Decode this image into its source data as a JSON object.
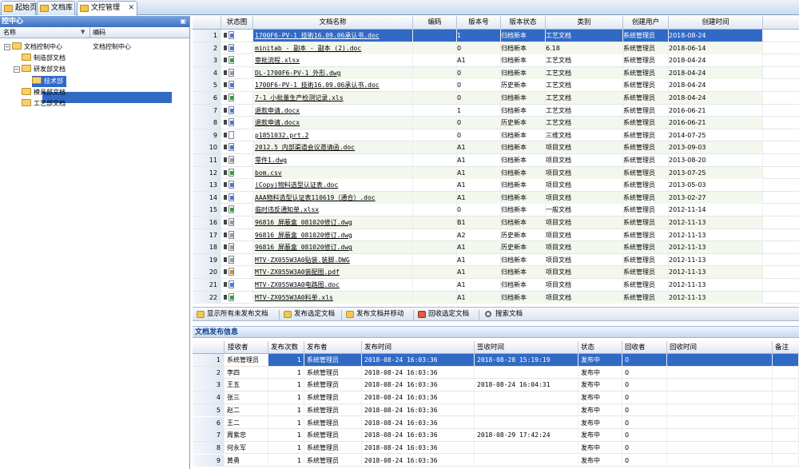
{
  "tabs": [
    {
      "label": "起始页",
      "active": false
    },
    {
      "label": "文档库",
      "active": false
    },
    {
      "label": "文控管理",
      "active": true
    }
  ],
  "tab_close": "✕",
  "left_panel": {
    "title": "控中心",
    "pin": "▣",
    "col_name": "名称",
    "col_code": "编码",
    "tree": [
      {
        "label": "文档控制中心",
        "code": "文档控制中心",
        "level": 0,
        "expanded": true
      },
      {
        "label": "制造部文档",
        "code": "",
        "level": 1,
        "expanded": false
      },
      {
        "label": "研发部文档",
        "code": "",
        "level": 1,
        "expanded": true
      },
      {
        "label": "技术部",
        "code": "",
        "level": 2,
        "selected": true
      },
      {
        "label": "模具部文档",
        "code": "",
        "level": 1,
        "expanded": false
      },
      {
        "label": "工艺部文档",
        "code": "",
        "level": 1,
        "expanded": false
      }
    ]
  },
  "doc_grid": {
    "headers": [
      "状态图",
      "文档名称",
      "编码",
      "版本号",
      "版本状态",
      "类别",
      "创建用户",
      "创建时间"
    ],
    "rows": [
      {
        "n": "1",
        "icon": "doc",
        "name": "1700F6-PV-1 技術16.09.06承认书.doc",
        "code": "",
        "ver": "1",
        "state": "归档新本",
        "cat": "工艺文档",
        "user": "系统管理员",
        "time": "2018-08-24"
      },
      {
        "n": "2",
        "icon": "doc",
        "name": "minitab - 副本 - 副本 (2).doc",
        "code": "",
        "ver": "0",
        "state": "归档新本",
        "cat": "6.18",
        "user": "系统管理员",
        "time": "2018-06-14"
      },
      {
        "n": "3",
        "icon": "xls",
        "name": "审批流程.xlsx",
        "code": "",
        "ver": "A1",
        "state": "归档新本",
        "cat": "工艺文档",
        "user": "系统管理员",
        "time": "2018-04-24"
      },
      {
        "n": "4",
        "icon": "dwg",
        "name": "DL-1700F6-PV-1 外形.dwg",
        "code": "",
        "ver": "0",
        "state": "归档新本",
        "cat": "工艺文档",
        "user": "系统管理员",
        "time": "2018-04-24"
      },
      {
        "n": "5",
        "icon": "doc",
        "name": "1700F6-PV-1 技術16.09.06承认书.doc",
        "code": "",
        "ver": "0",
        "state": "历史新本",
        "cat": "工艺文档",
        "user": "系统管理员",
        "time": "2018-04-24"
      },
      {
        "n": "6",
        "icon": "xls",
        "name": "7-1 小批量生产检测记录.xls",
        "code": "",
        "ver": "0",
        "state": "归档新本",
        "cat": "工艺文档",
        "user": "系统管理员",
        "time": "2018-04-24"
      },
      {
        "n": "7",
        "icon": "doc",
        "name": "退款申请.docx",
        "code": "",
        "ver": "1",
        "state": "归档新本",
        "cat": "工艺文档",
        "user": "系统管理员",
        "time": "2016-06-21"
      },
      {
        "n": "8",
        "icon": "doc",
        "name": "退款申请.docx",
        "code": "",
        "ver": "0",
        "state": "历史新本",
        "cat": "工艺文档",
        "user": "系统管理员",
        "time": "2016-06-21"
      },
      {
        "n": "9",
        "icon": "blank",
        "name": "p1851032.prt.2",
        "code": "",
        "ver": "0",
        "state": "归档新本",
        "cat": "三维文档",
        "user": "系统管理员",
        "time": "2014-07-25"
      },
      {
        "n": "10",
        "icon": "doc",
        "name": "2012.5 内部渠道会议邀请函.doc",
        "code": "",
        "ver": "A1",
        "state": "归档新本",
        "cat": "项目文档",
        "user": "系统管理员",
        "time": "2013-09-03"
      },
      {
        "n": "11",
        "icon": "dwg",
        "name": "零件1.dwg",
        "code": "",
        "ver": "A1",
        "state": "归档新本",
        "cat": "项目文档",
        "user": "系统管理员",
        "time": "2013-08-20"
      },
      {
        "n": "12",
        "icon": "xls",
        "name": "bom.csv",
        "code": "",
        "ver": "A1",
        "state": "归档新本",
        "cat": "项目文档",
        "user": "系统管理员",
        "time": "2013-07-25"
      },
      {
        "n": "13",
        "icon": "doc",
        "name": "(Copy)物料选型认证表.doc",
        "code": "",
        "ver": "A1",
        "state": "归档新本",
        "cat": "项目文档",
        "user": "系统管理员",
        "time": "2013-05-03"
      },
      {
        "n": "14",
        "icon": "doc",
        "name": "AAA物料选型认证表110619（通合）.doc",
        "code": "",
        "ver": "A1",
        "state": "归档新本",
        "cat": "项目文档",
        "user": "系统管理员",
        "time": "2013-02-27"
      },
      {
        "n": "15",
        "icon": "xls",
        "name": "临时违反通知单.xlsx",
        "code": "",
        "ver": "0",
        "state": "归档新本",
        "cat": "一般文档",
        "user": "系统管理员",
        "time": "2012-11-14"
      },
      {
        "n": "16",
        "icon": "dwg",
        "name": "96816 屏蔽盒 081020修订.dwg",
        "code": "",
        "ver": "B1",
        "state": "归档新本",
        "cat": "项目文档",
        "user": "系统管理员",
        "time": "2012-11-13"
      },
      {
        "n": "17",
        "icon": "dwg",
        "name": "96816 屏蔽盒 081020修订.dwg",
        "code": "",
        "ver": "A2",
        "state": "历史新本",
        "cat": "项目文档",
        "user": "系统管理员",
        "time": "2012-11-13"
      },
      {
        "n": "18",
        "icon": "dwg",
        "name": "96816 屏蔽盒 081020修订.dwg",
        "code": "",
        "ver": "A1",
        "state": "历史新本",
        "cat": "项目文档",
        "user": "系统管理员",
        "time": "2012-11-13"
      },
      {
        "n": "19",
        "icon": "dwg",
        "name": "MTV-ZX055W3A0贴装.装脚.DWG",
        "code": "",
        "ver": "A1",
        "state": "归档新本",
        "cat": "项目文档",
        "user": "系统管理员",
        "time": "2012-11-13"
      },
      {
        "n": "20",
        "icon": "pdf",
        "name": "MTV-ZX055W3A0装配图.pdf",
        "code": "",
        "ver": "A1",
        "state": "归档新本",
        "cat": "项目文档",
        "user": "系统管理员",
        "time": "2012-11-13"
      },
      {
        "n": "21",
        "icon": "doc",
        "name": "MTV-ZX055W3A0电路图.doc",
        "code": "",
        "ver": "A1",
        "state": "归档新本",
        "cat": "项目文档",
        "user": "系统管理员",
        "time": "2012-11-13"
      },
      {
        "n": "22",
        "icon": "xls",
        "name": "MTV-ZX055W3A0料单.xls",
        "code": "",
        "ver": "A1",
        "state": "归档新本",
        "cat": "项目文档",
        "user": "系统管理员",
        "time": "2012-11-13"
      }
    ]
  },
  "toolbar": {
    "show_unpublished": "显示所有未发布文档",
    "publish_selected": "发布选定文档",
    "publish_and_move": "发布文档并移动",
    "recall_selected": "回收选定文档",
    "search_docs": "搜索文档"
  },
  "publish_panel": {
    "title": "文档发布信息",
    "headers": [
      "接收者",
      "发布次数",
      "发布者",
      "发布时间",
      "签收时间",
      "状态",
      "回收者",
      "回收时间",
      "备注"
    ],
    "rows": [
      {
        "n": "1",
        "receiver": "系统管理员",
        "count": "1",
        "publisher": "系统管理员",
        "pub_time": "2018-08-24 16:03:36",
        "sign_time": "2018-08-28 15:19:19",
        "state": "发布中",
        "recaller": "0",
        "recall_time": "",
        "note": ""
      },
      {
        "n": "2",
        "receiver": "李四",
        "count": "1",
        "publisher": "系统管理员",
        "pub_time": "2018-08-24 16:03:36",
        "sign_time": "",
        "state": "发布中",
        "recaller": "0",
        "recall_time": "",
        "note": ""
      },
      {
        "n": "3",
        "receiver": "王五",
        "count": "1",
        "publisher": "系统管理员",
        "pub_time": "2018-08-24 16:03:36",
        "sign_time": "2018-08-24 16:04:31",
        "state": "发布中",
        "recaller": "0",
        "recall_time": "",
        "note": ""
      },
      {
        "n": "4",
        "receiver": "张三",
        "count": "1",
        "publisher": "系统管理员",
        "pub_time": "2018-08-24 16:03:36",
        "sign_time": "",
        "state": "发布中",
        "recaller": "0",
        "recall_time": "",
        "note": ""
      },
      {
        "n": "5",
        "receiver": "赵二",
        "count": "1",
        "publisher": "系统管理员",
        "pub_time": "2018-08-24 16:03:36",
        "sign_time": "",
        "state": "发布中",
        "recaller": "0",
        "recall_time": "",
        "note": ""
      },
      {
        "n": "6",
        "receiver": "王二",
        "count": "1",
        "publisher": "系统管理员",
        "pub_time": "2018-08-24 16:03:36",
        "sign_time": "",
        "state": "发布中",
        "recaller": "0",
        "recall_time": "",
        "note": ""
      },
      {
        "n": "7",
        "receiver": "周紫忠",
        "count": "1",
        "publisher": "系统管理员",
        "pub_time": "2018-08-24 16:03:36",
        "sign_time": "2018-08-29 17:42:24",
        "state": "发布中",
        "recaller": "0",
        "recall_time": "",
        "note": ""
      },
      {
        "n": "8",
        "receiver": "何永军",
        "count": "1",
        "publisher": "系统管理员",
        "pub_time": "2018-08-24 16:03:36",
        "sign_time": "",
        "state": "发布中",
        "recaller": "0",
        "recall_time": "",
        "note": ""
      },
      {
        "n": "9",
        "receiver": "黄勇",
        "count": "1",
        "publisher": "系统管理员",
        "pub_time": "2018-08-24 16:03:36",
        "sign_time": "",
        "state": "发布中",
        "recaller": "0",
        "recall_time": "",
        "note": ""
      }
    ]
  },
  "colors": {
    "selection": "#316ac5",
    "header_blue": "#3e6fc1",
    "panel_title": "#15428b"
  }
}
